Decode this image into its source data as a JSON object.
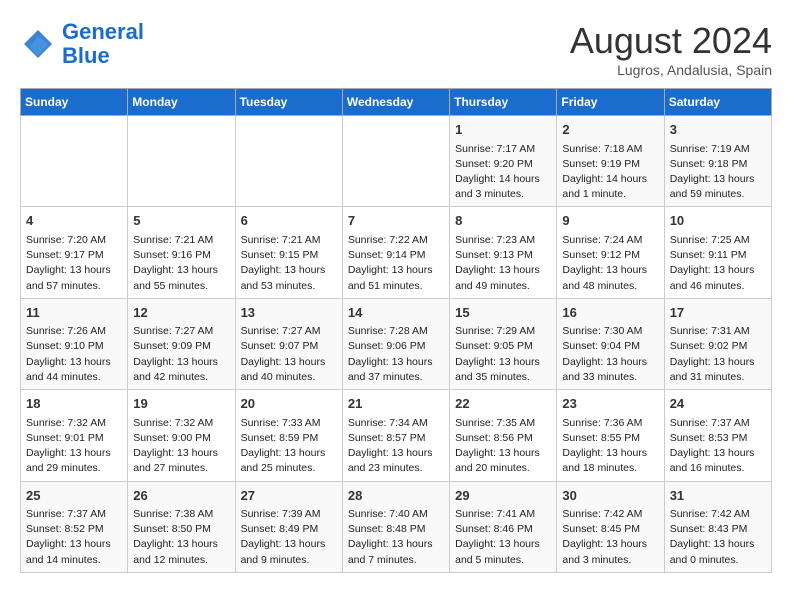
{
  "logo": {
    "line1": "General",
    "line2": "Blue"
  },
  "title": "August 2024",
  "subtitle": "Lugros, Andalusia, Spain",
  "headers": [
    "Sunday",
    "Monday",
    "Tuesday",
    "Wednesday",
    "Thursday",
    "Friday",
    "Saturday"
  ],
  "weeks": [
    [
      {
        "day": "",
        "info": ""
      },
      {
        "day": "",
        "info": ""
      },
      {
        "day": "",
        "info": ""
      },
      {
        "day": "",
        "info": ""
      },
      {
        "day": "1",
        "info": "Sunrise: 7:17 AM\nSunset: 9:20 PM\nDaylight: 14 hours\nand 3 minutes."
      },
      {
        "day": "2",
        "info": "Sunrise: 7:18 AM\nSunset: 9:19 PM\nDaylight: 14 hours\nand 1 minute."
      },
      {
        "day": "3",
        "info": "Sunrise: 7:19 AM\nSunset: 9:18 PM\nDaylight: 13 hours\nand 59 minutes."
      }
    ],
    [
      {
        "day": "4",
        "info": "Sunrise: 7:20 AM\nSunset: 9:17 PM\nDaylight: 13 hours\nand 57 minutes."
      },
      {
        "day": "5",
        "info": "Sunrise: 7:21 AM\nSunset: 9:16 PM\nDaylight: 13 hours\nand 55 minutes."
      },
      {
        "day": "6",
        "info": "Sunrise: 7:21 AM\nSunset: 9:15 PM\nDaylight: 13 hours\nand 53 minutes."
      },
      {
        "day": "7",
        "info": "Sunrise: 7:22 AM\nSunset: 9:14 PM\nDaylight: 13 hours\nand 51 minutes."
      },
      {
        "day": "8",
        "info": "Sunrise: 7:23 AM\nSunset: 9:13 PM\nDaylight: 13 hours\nand 49 minutes."
      },
      {
        "day": "9",
        "info": "Sunrise: 7:24 AM\nSunset: 9:12 PM\nDaylight: 13 hours\nand 48 minutes."
      },
      {
        "day": "10",
        "info": "Sunrise: 7:25 AM\nSunset: 9:11 PM\nDaylight: 13 hours\nand 46 minutes."
      }
    ],
    [
      {
        "day": "11",
        "info": "Sunrise: 7:26 AM\nSunset: 9:10 PM\nDaylight: 13 hours\nand 44 minutes."
      },
      {
        "day": "12",
        "info": "Sunrise: 7:27 AM\nSunset: 9:09 PM\nDaylight: 13 hours\nand 42 minutes."
      },
      {
        "day": "13",
        "info": "Sunrise: 7:27 AM\nSunset: 9:07 PM\nDaylight: 13 hours\nand 40 minutes."
      },
      {
        "day": "14",
        "info": "Sunrise: 7:28 AM\nSunset: 9:06 PM\nDaylight: 13 hours\nand 37 minutes."
      },
      {
        "day": "15",
        "info": "Sunrise: 7:29 AM\nSunset: 9:05 PM\nDaylight: 13 hours\nand 35 minutes."
      },
      {
        "day": "16",
        "info": "Sunrise: 7:30 AM\nSunset: 9:04 PM\nDaylight: 13 hours\nand 33 minutes."
      },
      {
        "day": "17",
        "info": "Sunrise: 7:31 AM\nSunset: 9:02 PM\nDaylight: 13 hours\nand 31 minutes."
      }
    ],
    [
      {
        "day": "18",
        "info": "Sunrise: 7:32 AM\nSunset: 9:01 PM\nDaylight: 13 hours\nand 29 minutes."
      },
      {
        "day": "19",
        "info": "Sunrise: 7:32 AM\nSunset: 9:00 PM\nDaylight: 13 hours\nand 27 minutes."
      },
      {
        "day": "20",
        "info": "Sunrise: 7:33 AM\nSunset: 8:59 PM\nDaylight: 13 hours\nand 25 minutes."
      },
      {
        "day": "21",
        "info": "Sunrise: 7:34 AM\nSunset: 8:57 PM\nDaylight: 13 hours\nand 23 minutes."
      },
      {
        "day": "22",
        "info": "Sunrise: 7:35 AM\nSunset: 8:56 PM\nDaylight: 13 hours\nand 20 minutes."
      },
      {
        "day": "23",
        "info": "Sunrise: 7:36 AM\nSunset: 8:55 PM\nDaylight: 13 hours\nand 18 minutes."
      },
      {
        "day": "24",
        "info": "Sunrise: 7:37 AM\nSunset: 8:53 PM\nDaylight: 13 hours\nand 16 minutes."
      }
    ],
    [
      {
        "day": "25",
        "info": "Sunrise: 7:37 AM\nSunset: 8:52 PM\nDaylight: 13 hours\nand 14 minutes."
      },
      {
        "day": "26",
        "info": "Sunrise: 7:38 AM\nSunset: 8:50 PM\nDaylight: 13 hours\nand 12 minutes."
      },
      {
        "day": "27",
        "info": "Sunrise: 7:39 AM\nSunset: 8:49 PM\nDaylight: 13 hours\nand 9 minutes."
      },
      {
        "day": "28",
        "info": "Sunrise: 7:40 AM\nSunset: 8:48 PM\nDaylight: 13 hours\nand 7 minutes."
      },
      {
        "day": "29",
        "info": "Sunrise: 7:41 AM\nSunset: 8:46 PM\nDaylight: 13 hours\nand 5 minutes."
      },
      {
        "day": "30",
        "info": "Sunrise: 7:42 AM\nSunset: 8:45 PM\nDaylight: 13 hours\nand 3 minutes."
      },
      {
        "day": "31",
        "info": "Sunrise: 7:42 AM\nSunset: 8:43 PM\nDaylight: 13 hours\nand 0 minutes."
      }
    ]
  ]
}
